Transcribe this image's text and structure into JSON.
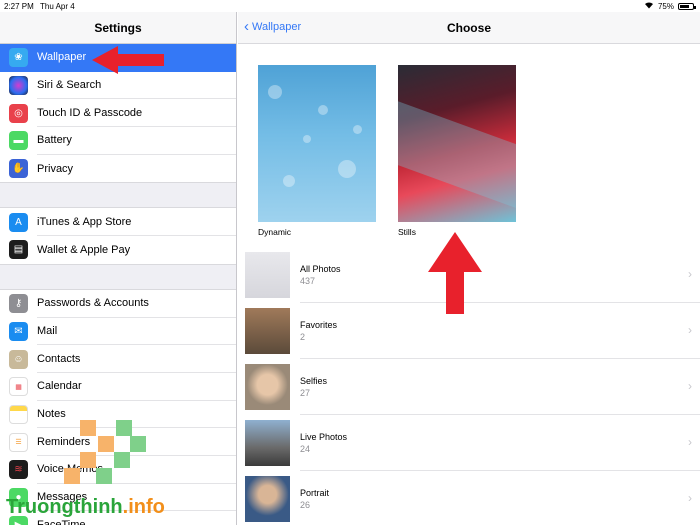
{
  "status": {
    "time": "2:27 PM",
    "date": "Thu Apr 4",
    "battery": "75%"
  },
  "left": {
    "title": "Settings",
    "group1": [
      {
        "label": "Wallpaper",
        "icon": "wallpaper-icon",
        "color": "#36aaf0"
      },
      {
        "label": "Siri & Search",
        "icon": "siri-icon",
        "color": "#1c1c2e"
      },
      {
        "label": "Touch ID & Passcode",
        "icon": "fingerprint-icon",
        "color": "#e9414b"
      },
      {
        "label": "Battery",
        "icon": "battery-icon",
        "color": "#4cd964"
      },
      {
        "label": "Privacy",
        "icon": "hand-icon",
        "color": "#3b63d6"
      }
    ],
    "group2": [
      {
        "label": "iTunes & App Store",
        "icon": "app-store-icon",
        "color": "#1a8cf0"
      },
      {
        "label": "Wallet & Apple Pay",
        "icon": "wallet-icon",
        "color": "#1c1c1c"
      }
    ],
    "group3": [
      {
        "label": "Passwords & Accounts",
        "icon": "key-icon",
        "color": "#8e8e93"
      },
      {
        "label": "Mail",
        "icon": "mail-icon",
        "color": "#1a8cf0"
      },
      {
        "label": "Contacts",
        "icon": "contacts-icon",
        "color": "#c8b99a"
      },
      {
        "label": "Calendar",
        "icon": "calendar-icon",
        "color": "#ffffff"
      },
      {
        "label": "Notes",
        "icon": "notes-icon",
        "color": "#ffd84a"
      },
      {
        "label": "Reminders",
        "icon": "reminders-icon",
        "color": "#ffffff"
      },
      {
        "label": "Voice Memos",
        "icon": "voice-memos-icon",
        "color": "#1c1c1c"
      },
      {
        "label": "Messages",
        "icon": "messages-icon",
        "color": "#4cd964"
      },
      {
        "label": "FaceTime",
        "icon": "facetime-icon",
        "color": "#4cd964"
      }
    ]
  },
  "right": {
    "back_label": "Wallpaper",
    "title": "Choose",
    "tiles": [
      {
        "label": "Dynamic"
      },
      {
        "label": "Stills"
      }
    ],
    "albums": [
      {
        "name": "All Photos",
        "count": "437"
      },
      {
        "name": "Favorites",
        "count": "2"
      },
      {
        "name": "Selfies",
        "count": "27"
      },
      {
        "name": "Live Photos",
        "count": "24"
      },
      {
        "name": "Portrait",
        "count": "26"
      }
    ]
  },
  "watermark": {
    "main": "Truongthinh",
    "dot": ".info"
  },
  "accent": "#3478f6"
}
